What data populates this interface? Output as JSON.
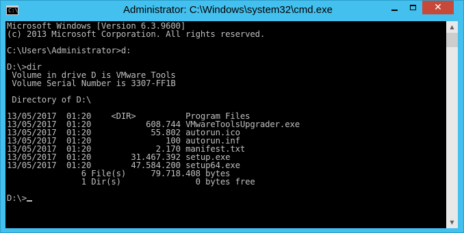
{
  "window": {
    "title": "Administrator: C:\\Windows\\system32\\cmd.exe",
    "icon_text": "C:\\",
    "minimize_label": "",
    "close_label": "✕"
  },
  "console": {
    "lines": [
      "Microsoft Windows [Version 6.3.9600]",
      "(c) 2013 Microsoft Corporation. All rights reserved.",
      "",
      "C:\\Users\\Administrator>d:",
      "",
      "D:\\>dir",
      " Volume in drive D is VMware Tools",
      " Volume Serial Number is 3307-FF1B",
      "",
      " Directory of D:\\",
      "",
      "13/05/2017  01:20    <DIR>          Program Files",
      "13/05/2017  01:20           608.744 VMwareToolsUpgrader.exe",
      "13/05/2017  01:20            55.802 autorun.ico",
      "13/05/2017  01:20               100 autorun.inf",
      "13/05/2017  01:20             2.170 manifest.txt",
      "13/05/2017  01:20        31.467.392 setup.exe",
      "13/05/2017  01:20        47.584.200 setup64.exe",
      "               6 File(s)     79.718.408 bytes",
      "               1 Dir(s)               0 bytes free",
      "",
      "D:\\>"
    ]
  },
  "scrollbar": {
    "up_arrow": "▲",
    "down_arrow": "▼"
  }
}
